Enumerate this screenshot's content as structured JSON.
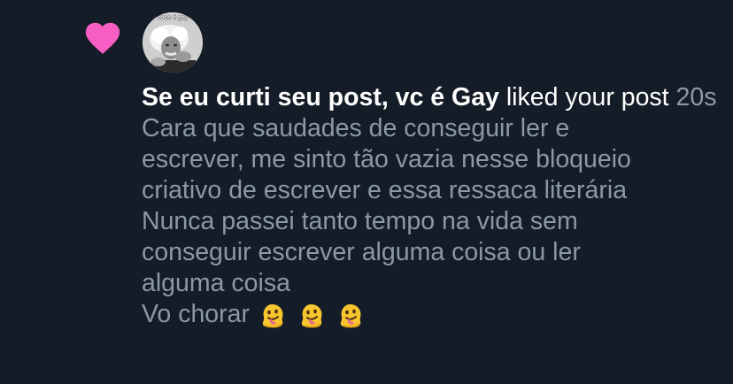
{
  "notification": {
    "type_icon": "heart-icon",
    "avatar_caption": "voce é gay",
    "user_name": "Se eu curti seu post, vc é Gay",
    "action_text": "liked your post",
    "timestamp": "20s",
    "post_lines": [
      "Cara que saudades de conseguir ler e",
      "escrever, me sinto tão vazia nesse bloqueio",
      "criativo de escrever e essa ressaca literária",
      "Nunca passei tanto tempo na vida sem",
      "conseguir escrever alguma coisa ou ler",
      "alguma coisa"
    ],
    "last_line": "Vo chorar",
    "emojis": [
      "melting-face-emoji",
      "melting-face-emoji",
      "melting-face-emoji"
    ],
    "colors": {
      "background": "#141c27",
      "heart": "#f65ec4",
      "primary_text": "#ffffff",
      "secondary_text": "#8b98a5"
    }
  }
}
